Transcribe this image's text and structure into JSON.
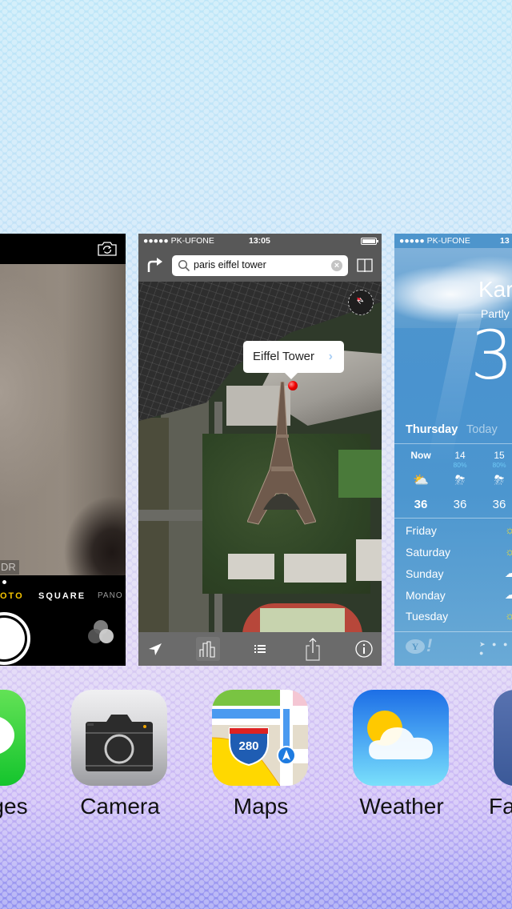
{
  "switcher": {
    "cards": {
      "camera": {
        "app": "Camera",
        "hdr_label": "DR",
        "modes": {
          "photo": "OTO",
          "square": "SQUARE",
          "pano": "PANO"
        },
        "active_mode": "photo",
        "icons": {
          "flip": "camera-flip-icon",
          "filters": "filters-icon"
        }
      },
      "maps": {
        "app": "Maps",
        "status": {
          "carrier": "●●●●● PK-UFONE",
          "time": "13:05"
        },
        "search": {
          "value": "paris eiffel tower",
          "clear": "×"
        },
        "callout": {
          "title": "Eiffel Tower",
          "chevron": "›"
        },
        "compass_label": "N",
        "toolbar": [
          "location-arrow-icon",
          "3d-buildings-icon",
          "list-icon",
          "share-icon",
          "info-icon"
        ],
        "active_tool": "3d-buildings-icon"
      },
      "weather": {
        "app": "Weather",
        "status": {
          "carrier": "●●●●● PK-UFONE",
          "time": "13"
        },
        "city": "Kar",
        "condition": "Partly",
        "temperature": "3",
        "day": "Thursday",
        "today_label": "Today",
        "hourly": [
          {
            "hour": "Now",
            "pop": "",
            "icon": "partly-cloudy-icon",
            "glyph": "⛅",
            "temp": "36"
          },
          {
            "hour": "14",
            "pop": "80%",
            "icon": "thunderstorm-icon",
            "glyph": "⛈",
            "temp": "36"
          },
          {
            "hour": "15",
            "pop": "80%",
            "icon": "thunderstorm-icon",
            "glyph": "⛈",
            "temp": "36"
          }
        ],
        "daily": [
          {
            "day": "Friday",
            "icon": "sun-icon",
            "glyph": "☼"
          },
          {
            "day": "Saturday",
            "icon": "sun-icon",
            "glyph": "☼"
          },
          {
            "day": "Sunday",
            "icon": "cloud-icon",
            "glyph": "☁"
          },
          {
            "day": "Monday",
            "icon": "cloud-icon",
            "glyph": "☁"
          },
          {
            "day": "Tuesday",
            "icon": "sun-icon",
            "glyph": "☼"
          }
        ],
        "yahoo": {
          "y": "Y",
          "bang": "!"
        },
        "page_dots": "➤ ● ● ●"
      }
    }
  },
  "apps": [
    {
      "id": "messages",
      "label": "ges"
    },
    {
      "id": "camera",
      "label": "Camera"
    },
    {
      "id": "maps",
      "label": "Maps",
      "shield": "280"
    },
    {
      "id": "weather",
      "label": "Weather"
    },
    {
      "id": "facebook",
      "label": "Fa"
    }
  ],
  "colors": {
    "camera_mode_active": "#f5c400",
    "maps_pin": "#e00000",
    "weather_pop": "#6fc8f5"
  }
}
